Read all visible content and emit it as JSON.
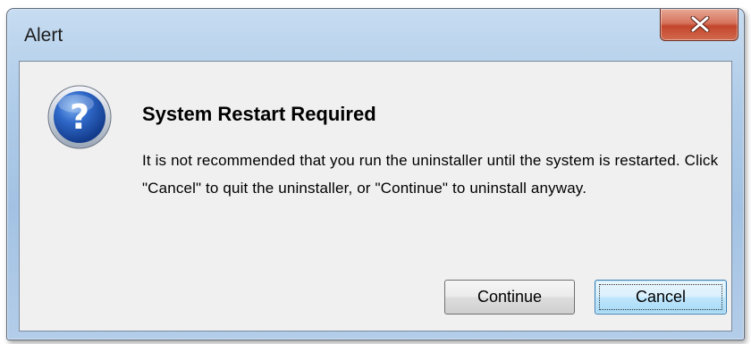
{
  "window": {
    "title": "Alert"
  },
  "dialog": {
    "icon": "question-mark-icon",
    "heading": "System Restart Required",
    "message": "It is not recommended that you run the uninstaller until the system is restarted.  Click \"Cancel\" to quit the uninstaller, or \"Continue\" to uninstall anyway."
  },
  "buttons": {
    "continue_label": "Continue",
    "cancel_label": "Cancel",
    "close_icon": "close-x-icon",
    "default": "Cancel"
  },
  "colors": {
    "close_button": "#c3462b",
    "icon_blue": "#1f4fa8",
    "default_button_border": "#3c7fb1"
  }
}
